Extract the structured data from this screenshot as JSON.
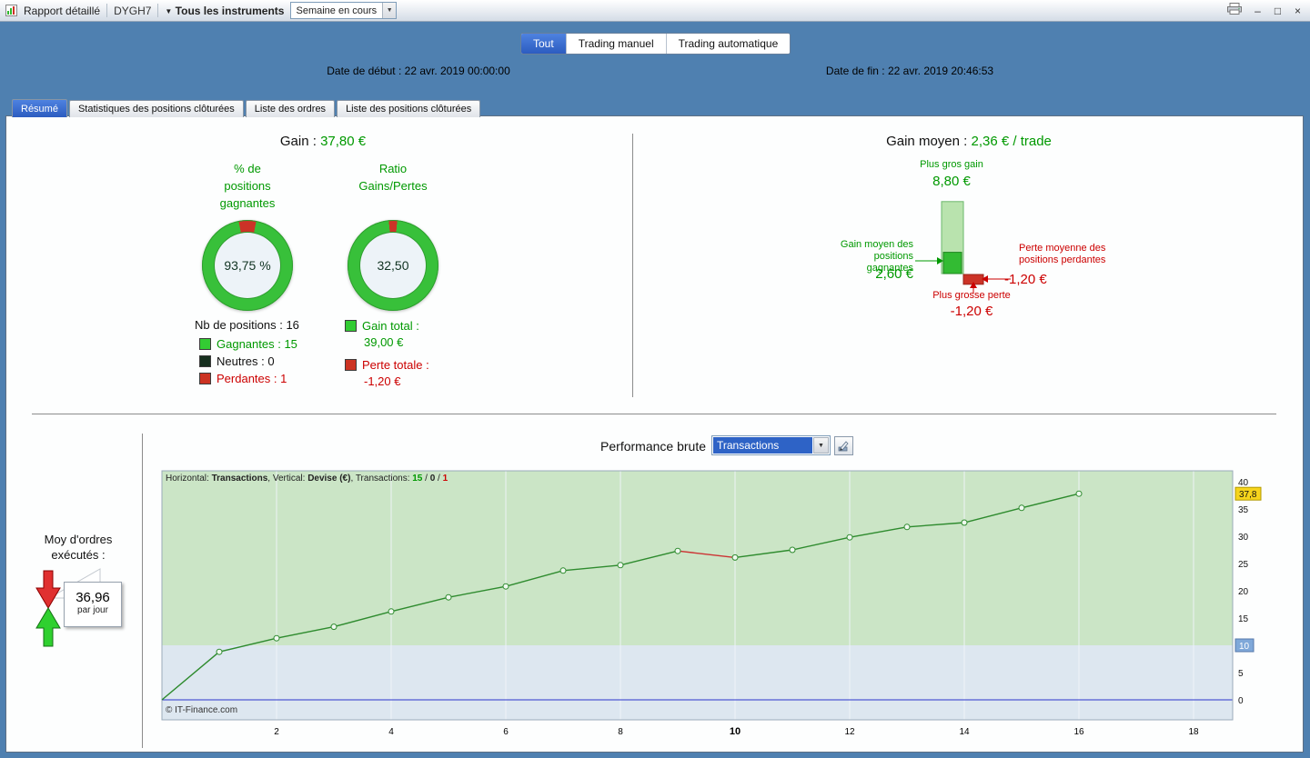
{
  "icons": {
    "dropdown": "▼",
    "minimize": "–",
    "maximize": "□",
    "close": "×"
  },
  "colors": {
    "green": "#009900",
    "red": "#cc0000",
    "accent_blue": "#2e63c6",
    "donut_green": "#38c03a",
    "donut_red": "#cc3327",
    "bar_pale_green": "#b9e3ae",
    "bar_green": "#33bb33",
    "bar_red": "#cc3327"
  },
  "titlebar": {
    "title": "Rapport détaillé",
    "instrument": "DYGH7",
    "instruments_filter": "Tous les instruments",
    "period": "Semaine en cours"
  },
  "header": {
    "tabs": [
      {
        "label": "Tout"
      },
      {
        "label": "Trading manuel"
      },
      {
        "label": "Trading automatique"
      }
    ],
    "date_start_label": "Date de début :",
    "date_start_value": "22 avr. 2019 00:00:00",
    "date_end_label": "Date de fin :",
    "date_end_value": "22 avr. 2019 20:46:53"
  },
  "panel_tabs": [
    {
      "label": "Résumé"
    },
    {
      "label": "Statistiques des positions clôturées"
    },
    {
      "label": "Liste des ordres"
    },
    {
      "label": "Liste des positions clôturées"
    }
  ],
  "summary": {
    "gain_label": "Gain :",
    "gain_value": "37,80 €",
    "donut1": {
      "line1": "% de",
      "line2": "positions",
      "line3": "gagnantes",
      "value": "93,75 %",
      "red_deg": 22.5
    },
    "donut2": {
      "line1": "Ratio",
      "line2": "Gains/Pertes",
      "value": "32,50",
      "red_deg": 10.8
    },
    "nb_positions": "Nb de positions : 16",
    "legend": [
      {
        "label": "Gagnantes : 15",
        "swatch": "#33cc33"
      },
      {
        "label": "Neutres : 0",
        "swatch": "#17301f"
      },
      {
        "label": "Perdantes : 1",
        "swatch": "#cc3322"
      }
    ],
    "gain_total_label": "Gain total :",
    "gain_total_value": "39,00 €",
    "gain_total_swatch": "#33cc33",
    "loss_total_label": "Perte totale :",
    "loss_total_value": "-1,20 €",
    "loss_total_swatch": "#cc3322"
  },
  "gain_moyen": {
    "label": "Gain moyen :",
    "value": "2,36 € / trade",
    "max_gain_label": "Plus gros gain",
    "max_gain_value": "8,80 €",
    "avg_gain_label_1": "Gain moyen des positions",
    "avg_gain_label_2": "gagnantes",
    "avg_gain_value": "2,60 €",
    "avg_loss_label_1": "Perte moyenne des",
    "avg_loss_label_2": "positions perdantes",
    "avg_loss_value": "-1,20 €",
    "max_loss_label": "Plus grosse perte",
    "max_loss_value": "-1,20 €",
    "bars": {
      "max_gain": 8.8,
      "avg_gain": 2.6,
      "max_loss": 1.2
    }
  },
  "performance": {
    "title": "Performance brute",
    "select_value": "Transactions",
    "orders_label_1": "Moy d'ordres",
    "orders_label_2": "exécutés :",
    "orders_value": "36,96",
    "orders_unit": "par jour"
  },
  "chart_data": {
    "type": "line",
    "title": "Performance brute",
    "xlabel": "Transactions",
    "ylabel": "Devise (€)",
    "x": [
      0,
      1,
      2,
      3,
      4,
      5,
      6,
      7,
      8,
      9,
      10,
      11,
      12,
      13,
      14,
      15,
      16
    ],
    "values": [
      0,
      8.8,
      11.3,
      13.4,
      16.2,
      18.8,
      20.8,
      23.7,
      24.7,
      27.3,
      26.1,
      27.5,
      29.8,
      31.7,
      32.5,
      35.2,
      37.8
    ],
    "loss_from_index": 9,
    "xticks": [
      2,
      4,
      6,
      8,
      10,
      12,
      14,
      16,
      18
    ],
    "bold_xtick": 10,
    "yticks": [
      0,
      5,
      10,
      15,
      20,
      25,
      30,
      35,
      40
    ],
    "ylim": [
      -3.6,
      42
    ],
    "xlim": [
      0,
      18.7
    ],
    "band_min": 10,
    "grid": "vertical",
    "final_badge": {
      "text": "37,8",
      "value": 37.8,
      "bg": "#f6d41c",
      "border": "#b29a00",
      "fg": "#111111"
    },
    "level_badge": {
      "text": "10",
      "value": 10,
      "bg": "#7fa8d9",
      "border": "#5578aa",
      "fg": "#ffffff"
    },
    "colors": {
      "line": "#2e8b2e",
      "loss": "#cc3333",
      "band": "#cbe5c6",
      "bg": "#dde7f0",
      "zero": "#2a35cc",
      "grid": "#eef3f7",
      "marker_fill": "#f0f8f0",
      "border": "#9aabba"
    },
    "info_parts": [
      {
        "t": "Horizontal: "
      },
      {
        "t": "Transactions",
        "b": true
      },
      {
        "t": ", Vertical: "
      },
      {
        "t": "Devise (€)",
        "b": true
      },
      {
        "t": ", Transactions: "
      },
      {
        "t": "15",
        "b": true,
        "c": "#009900"
      },
      {
        "t": " / "
      },
      {
        "t": "0",
        "b": true,
        "c": "#222222"
      },
      {
        "t": " / "
      },
      {
        "t": "1",
        "b": true,
        "c": "#cc0000"
      }
    ],
    "copyright": "© IT-Finance.com"
  }
}
